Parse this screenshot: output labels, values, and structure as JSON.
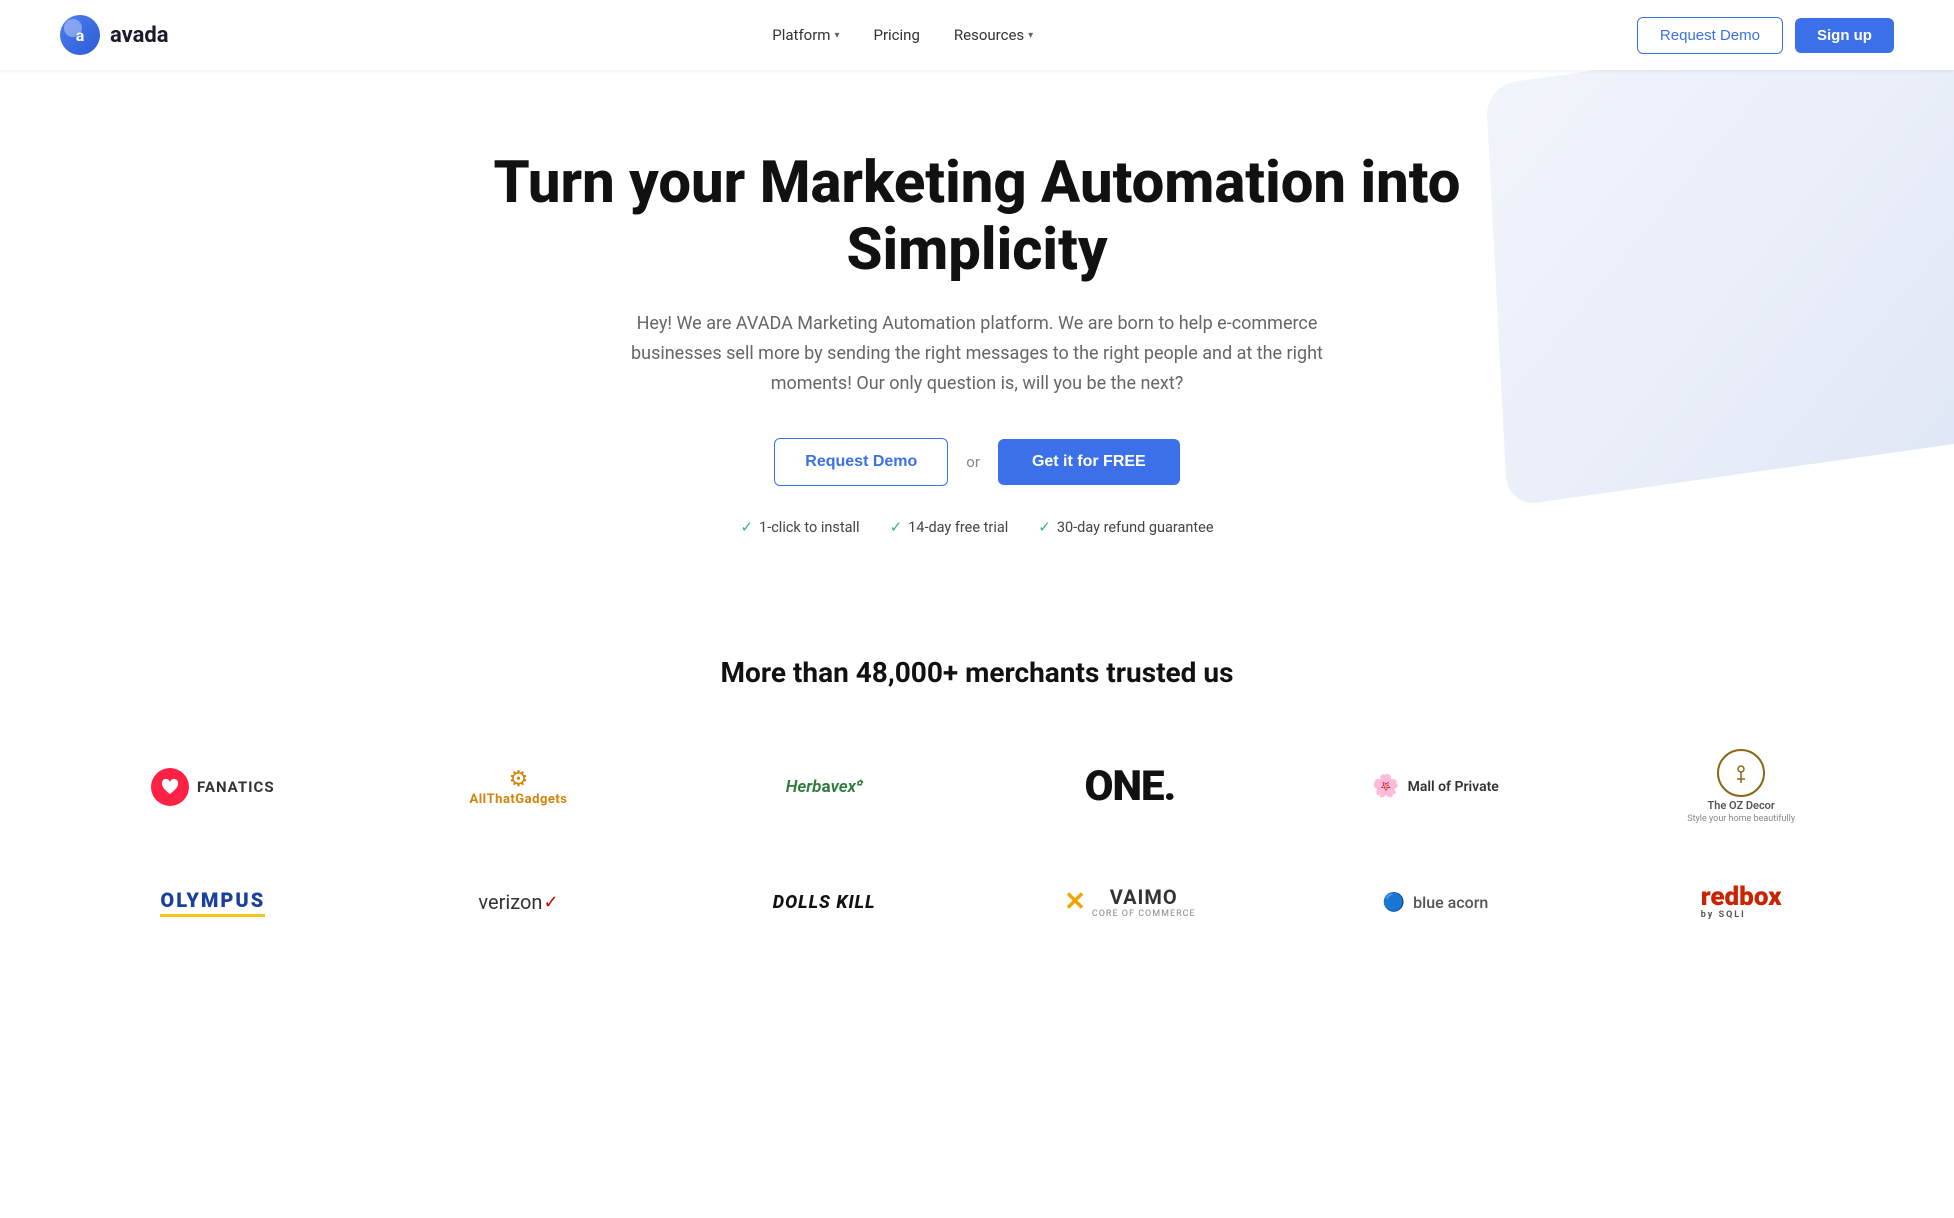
{
  "nav": {
    "logo_letter": "a",
    "logo_name": "avada",
    "links": [
      {
        "id": "platform",
        "label": "Platform",
        "hasDropdown": true
      },
      {
        "id": "pricing",
        "label": "Pricing",
        "hasDropdown": false
      },
      {
        "id": "resources",
        "label": "Resources",
        "hasDropdown": true
      }
    ],
    "request_demo": "Request Demo",
    "sign_up": "Sign up"
  },
  "hero": {
    "title": "Turn your Marketing Automation into Simplicity",
    "subtitle": "Hey! We are AVADA Marketing Automation platform. We are born to help e-commerce businesses sell more by sending the right messages to the right people and at the right moments! Our only question is, will you be the next?",
    "cta_demo": "Request Demo",
    "cta_or": "or",
    "cta_free": "Get it for FREE",
    "features": [
      "1-click to install",
      "14-day free trial",
      "30-day refund guarantee"
    ]
  },
  "trusted": {
    "title": "More than 48,000+ merchants trusted us",
    "logos_row1": [
      {
        "id": "fanatics",
        "name": "Fanatics"
      },
      {
        "id": "atg",
        "name": "AllThatGadgets"
      },
      {
        "id": "herbavex",
        "name": "Herbavex"
      },
      {
        "id": "one",
        "name": "ONE."
      },
      {
        "id": "mallofprivate",
        "name": "Mall of Private"
      },
      {
        "id": "ozdecor",
        "name": "The OZ Decor"
      }
    ],
    "logos_row2": [
      {
        "id": "olympus",
        "name": "OLYMPUS"
      },
      {
        "id": "verizon",
        "name": "verizon"
      },
      {
        "id": "dollskill",
        "name": "DOLLS KILL"
      },
      {
        "id": "vaimo",
        "name": "VAIMO"
      },
      {
        "id": "blueacorn",
        "name": "blue acorn"
      },
      {
        "id": "redbox",
        "name": "redbox by SQLI"
      }
    ]
  },
  "colors": {
    "primary_blue": "#3b70e8",
    "green_check": "#2eba72",
    "text_dark": "#111111",
    "text_muted": "#666666"
  }
}
